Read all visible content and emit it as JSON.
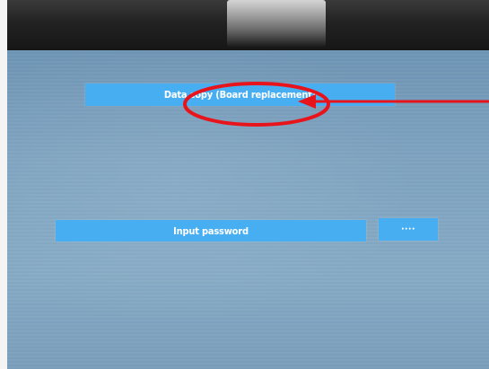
{
  "menu": {
    "data_copy_label": "Data copy (Board replacement)",
    "input_password_label": "Input password",
    "password_mask": "••••"
  },
  "annotation": {
    "color": "#e8141c"
  },
  "colors": {
    "menu_bar": "#48aef2",
    "screen_background": "#7fa4c1",
    "bezel": "#222222"
  }
}
